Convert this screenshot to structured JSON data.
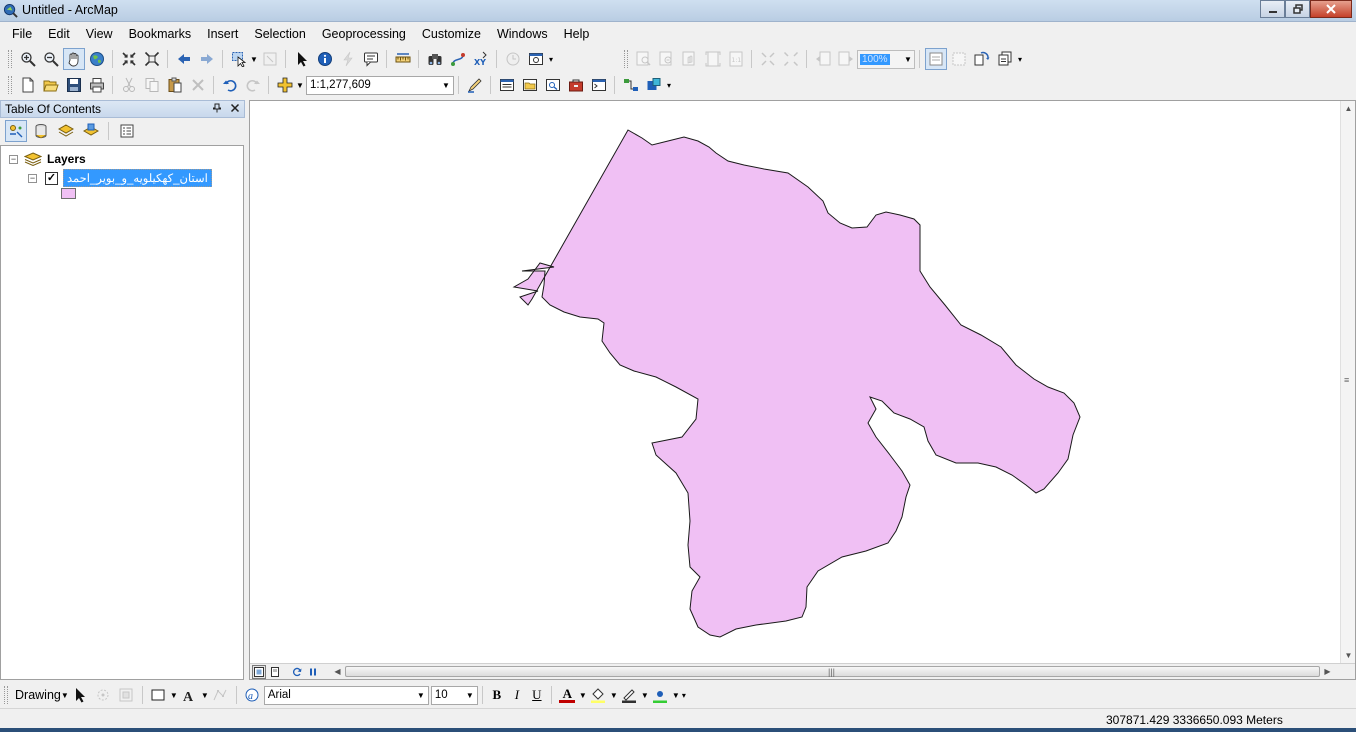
{
  "window": {
    "title": "Untitled - ArcMap"
  },
  "menu": [
    "File",
    "Edit",
    "View",
    "Bookmarks",
    "Insert",
    "Selection",
    "Geoprocessing",
    "Customize",
    "Windows",
    "Help"
  ],
  "standard_toolbar": {
    "scale_value": "1:1,277,609"
  },
  "layout_toolbar": {
    "zoom_value": "100%"
  },
  "toc": {
    "title": "Table Of Contents",
    "root_label": "Layers",
    "layer_name": "استان_کهکیلویه_و_بویر_احمد",
    "layer_checked": true,
    "symbol_color": "#f0c0f4"
  },
  "map": {
    "polygon_fill": "#f0c0f4",
    "polygon_stroke": "#1a1a1a"
  },
  "drawing_toolbar": {
    "label": "Drawing",
    "font_name": "Arial",
    "font_size": "10",
    "bold_label": "B",
    "italic_label": "I",
    "underline_label": "U",
    "font_color_label": "A"
  },
  "status": {
    "coordinates": "307871.429  3336650.093 Meters"
  },
  "colors": {
    "selection": "#3399ff",
    "font_color": "#c00000",
    "fill_color": "#ffff66",
    "line_color": "#303030",
    "marker_color": "#33cc33"
  }
}
